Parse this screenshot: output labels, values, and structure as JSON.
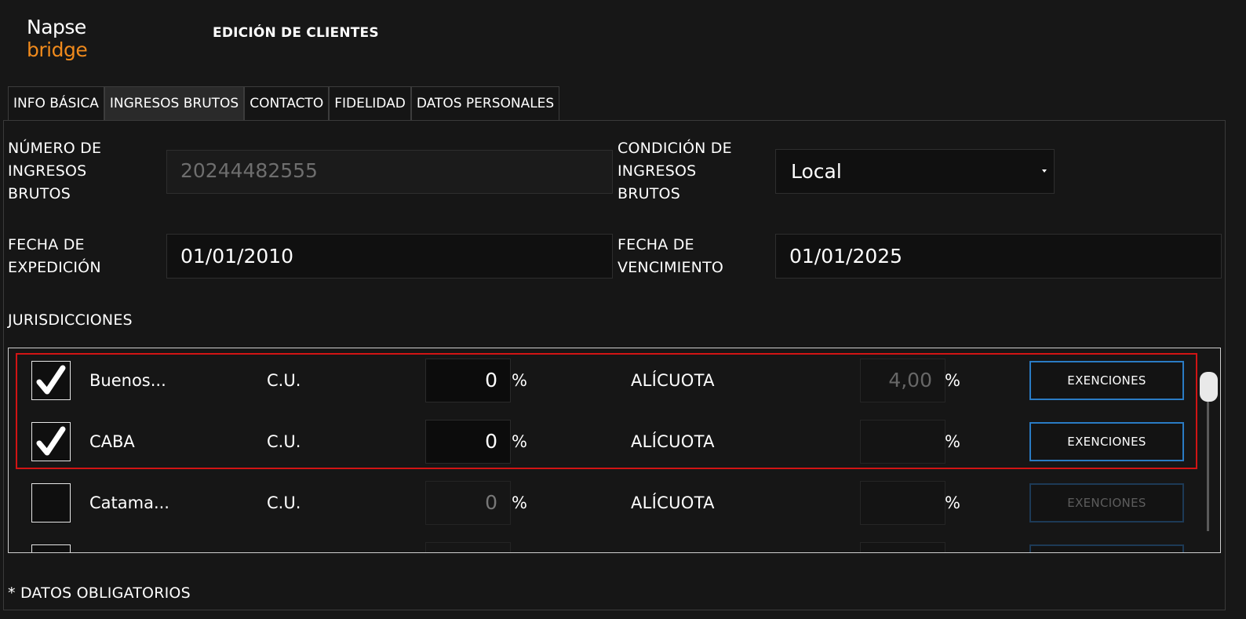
{
  "logo": {
    "line1": "Napse",
    "line2": "bridge",
    "accent_color": "#f08a1c"
  },
  "page_title": "EDICIÓN DE CLIENTES",
  "tabs": [
    {
      "label": "INFO BÁSICA",
      "active": false
    },
    {
      "label": "INGRESOS BRUTOS",
      "active": true
    },
    {
      "label": "CONTACTO",
      "active": false
    },
    {
      "label": "FIDELIDAD",
      "active": false
    },
    {
      "label": "DATOS PERSONALES",
      "active": false
    }
  ],
  "form": {
    "numero": {
      "label_lines": [
        "NÚMERO DE",
        "INGRESOS",
        "BRUTOS"
      ],
      "value": "20244482555"
    },
    "condicion": {
      "label_lines": [
        "CONDICIÓN DE",
        "INGRESOS",
        "BRUTOS"
      ],
      "value": "Local"
    },
    "fecha_exp": {
      "label_lines": [
        "FECHA DE",
        "EXPEDICIÓN"
      ],
      "value": "01/01/2010"
    },
    "fecha_venc": {
      "label_lines": [
        "FECHA DE",
        "VENCIMIENTO"
      ],
      "value": "01/01/2025"
    }
  },
  "jurisdicciones": {
    "heading": "JURISDICCIONES",
    "cu_label": "C.U.",
    "alicuota_label": "ALÍCUOTA",
    "percent": "%",
    "exenciones_label": "EXENCIONES",
    "rows": [
      {
        "name": "Buenos...",
        "checked": true,
        "cu": "0",
        "alicuota": "4,00"
      },
      {
        "name": "CABA",
        "checked": true,
        "cu": "0",
        "alicuota": ""
      },
      {
        "name": "Catama...",
        "checked": false,
        "cu": "0",
        "alicuota": ""
      },
      {
        "name": "",
        "checked": false,
        "cu": "",
        "alicuota": ""
      }
    ]
  },
  "footer": "* DATOS OBLIGATORIOS",
  "colors": {
    "highlight": "#d11414",
    "button_border": "#2a7bc4",
    "background": "#171717"
  }
}
